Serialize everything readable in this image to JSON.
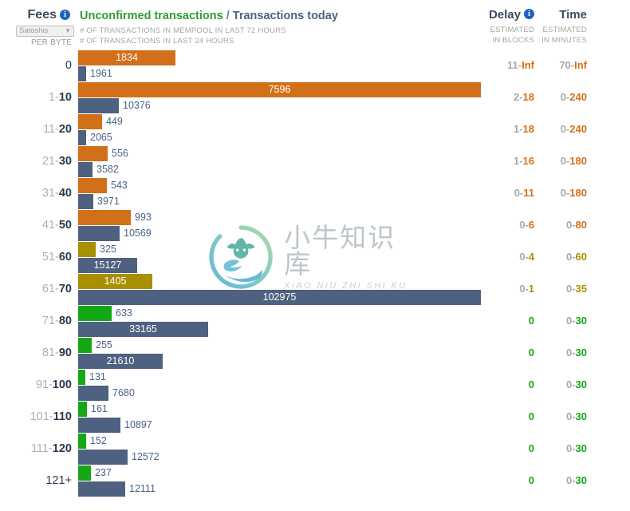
{
  "header": {
    "fees_title": "Fees",
    "fees_info_icon": "info-icon",
    "unit_label": "Satoshis",
    "unit_caret": "▼",
    "per_byte": "PER BYTE",
    "title_part1": "Unconfirmed transactions",
    "title_sep": " / ",
    "title_part2": "Transactions today",
    "subtitle1": "# OF TRANSACTIONS IN MEMPOOL IN LAST 72 HOURS",
    "subtitle2": "# OF TRANSACTIONS IN LAST 24 HOURS",
    "delay_title": "Delay",
    "delay_info_icon": "info-icon",
    "delay_sub1": "ESTIMATED",
    "delay_sub2": "IN BLOCKS",
    "time_title": "Time",
    "time_sub1": "ESTIMATED",
    "time_sub2": "IN MINUTES"
  },
  "watermark": {
    "cn": "小牛知识库",
    "en": "XIAO NIU ZHI SHI KU"
  },
  "colors": {
    "orange": "#d2701a",
    "olive": "#a89000",
    "green": "#14a814",
    "blue": "#4f6180",
    "label_dim": "#aeaeae",
    "label_dark": "#2b3a4d",
    "title_green": "#2e9e2e",
    "title_blue": "#4f6180"
  },
  "chart_data": {
    "type": "bar",
    "title": "Unconfirmed transactions / Transactions today",
    "xlabel": "",
    "ylabel": "Fees (Satoshis per byte)",
    "orientation": "horizontal",
    "grid": false,
    "legend": [
      "# of transactions in mempool in last 72 hours",
      "# of transactions in last 24 hours"
    ],
    "categories": [
      "0",
      "1-10",
      "11-20",
      "21-30",
      "31-40",
      "41-50",
      "51-60",
      "61-70",
      "71-80",
      "81-90",
      "91-100",
      "101-110",
      "111-120",
      "121+"
    ],
    "series": [
      {
        "name": "# of transactions in mempool in last 72 hours",
        "values": [
          1834,
          7596,
          449,
          556,
          543,
          993,
          325,
          1405,
          633,
          255,
          131,
          161,
          152,
          237
        ],
        "max": 7596
      },
      {
        "name": "# of transactions in last 24 hours",
        "values": [
          1961,
          10376,
          2065,
          3582,
          3971,
          10569,
          15127,
          102975,
          33165,
          21610,
          7680,
          10897,
          12572,
          12111
        ],
        "max": 102975
      }
    ]
  },
  "rows": [
    {
      "label_lo": "",
      "label_hi": "",
      "label_plain": "0",
      "mempool": 1834,
      "today": 1961,
      "color": "orange",
      "delay_lo": "11",
      "delay_hi": "Inf",
      "delay_sep": "-",
      "time_lo": "70",
      "time_hi": "Inf",
      "time_sep": "-"
    },
    {
      "label_lo": "1",
      "label_hi": "10",
      "label_plain": "",
      "mempool": 7596,
      "today": 10376,
      "color": "orange",
      "delay_lo": "2",
      "delay_hi": "18",
      "delay_sep": "-",
      "time_lo": "0",
      "time_hi": "240",
      "time_sep": "-"
    },
    {
      "label_lo": "11",
      "label_hi": "20",
      "label_plain": "",
      "mempool": 449,
      "today": 2065,
      "color": "orange",
      "delay_lo": "1",
      "delay_hi": "18",
      "delay_sep": "-",
      "time_lo": "0",
      "time_hi": "240",
      "time_sep": "-"
    },
    {
      "label_lo": "21",
      "label_hi": "30",
      "label_plain": "",
      "mempool": 556,
      "today": 3582,
      "color": "orange",
      "delay_lo": "1",
      "delay_hi": "16",
      "delay_sep": "-",
      "time_lo": "0",
      "time_hi": "180",
      "time_sep": "-"
    },
    {
      "label_lo": "31",
      "label_hi": "40",
      "label_plain": "",
      "mempool": 543,
      "today": 3971,
      "color": "orange",
      "delay_lo": "0",
      "delay_hi": "11",
      "delay_sep": "-",
      "time_lo": "0",
      "time_hi": "180",
      "time_sep": "-"
    },
    {
      "label_lo": "41",
      "label_hi": "50",
      "label_plain": "",
      "mempool": 993,
      "today": 10569,
      "color": "orange",
      "delay_lo": "0",
      "delay_hi": "6",
      "delay_sep": "-",
      "time_lo": "0",
      "time_hi": "80",
      "time_sep": "-"
    },
    {
      "label_lo": "51",
      "label_hi": "60",
      "label_plain": "",
      "mempool": 325,
      "today": 15127,
      "color": "olive",
      "delay_lo": "0",
      "delay_hi": "4",
      "delay_sep": "-",
      "time_lo": "0",
      "time_hi": "60",
      "time_sep": "-"
    },
    {
      "label_lo": "61",
      "label_hi": "70",
      "label_plain": "",
      "mempool": 1405,
      "today": 102975,
      "color": "olive",
      "delay_lo": "0",
      "delay_hi": "1",
      "delay_sep": "-",
      "time_lo": "0",
      "time_hi": "35",
      "time_sep": "-"
    },
    {
      "label_lo": "71",
      "label_hi": "80",
      "label_plain": "",
      "mempool": 633,
      "today": 33165,
      "color": "green",
      "delay_lo": "",
      "delay_hi": "0",
      "delay_sep": "",
      "time_lo": "0",
      "time_hi": "30",
      "time_sep": "-"
    },
    {
      "label_lo": "81",
      "label_hi": "90",
      "label_plain": "",
      "mempool": 255,
      "today": 21610,
      "color": "green",
      "delay_lo": "",
      "delay_hi": "0",
      "delay_sep": "",
      "time_lo": "0",
      "time_hi": "30",
      "time_sep": "-"
    },
    {
      "label_lo": "91",
      "label_hi": "100",
      "label_plain": "",
      "mempool": 131,
      "today": 7680,
      "color": "green",
      "delay_lo": "",
      "delay_hi": "0",
      "delay_sep": "",
      "time_lo": "0",
      "time_hi": "30",
      "time_sep": "-"
    },
    {
      "label_lo": "101",
      "label_hi": "110",
      "label_plain": "",
      "mempool": 161,
      "today": 10897,
      "color": "green",
      "delay_lo": "",
      "delay_hi": "0",
      "delay_sep": "",
      "time_lo": "0",
      "time_hi": "30",
      "time_sep": "-"
    },
    {
      "label_lo": "111",
      "label_hi": "120",
      "label_plain": "",
      "mempool": 152,
      "today": 12572,
      "color": "green",
      "delay_lo": "",
      "delay_hi": "0",
      "delay_sep": "",
      "time_lo": "0",
      "time_hi": "30",
      "time_sep": "-"
    },
    {
      "label_lo": "",
      "label_hi": "",
      "label_plain": "121+",
      "mempool": 237,
      "today": 12111,
      "color": "green",
      "delay_lo": "",
      "delay_hi": "0",
      "delay_sep": "",
      "time_lo": "0",
      "time_hi": "30",
      "time_sep": "-"
    }
  ]
}
